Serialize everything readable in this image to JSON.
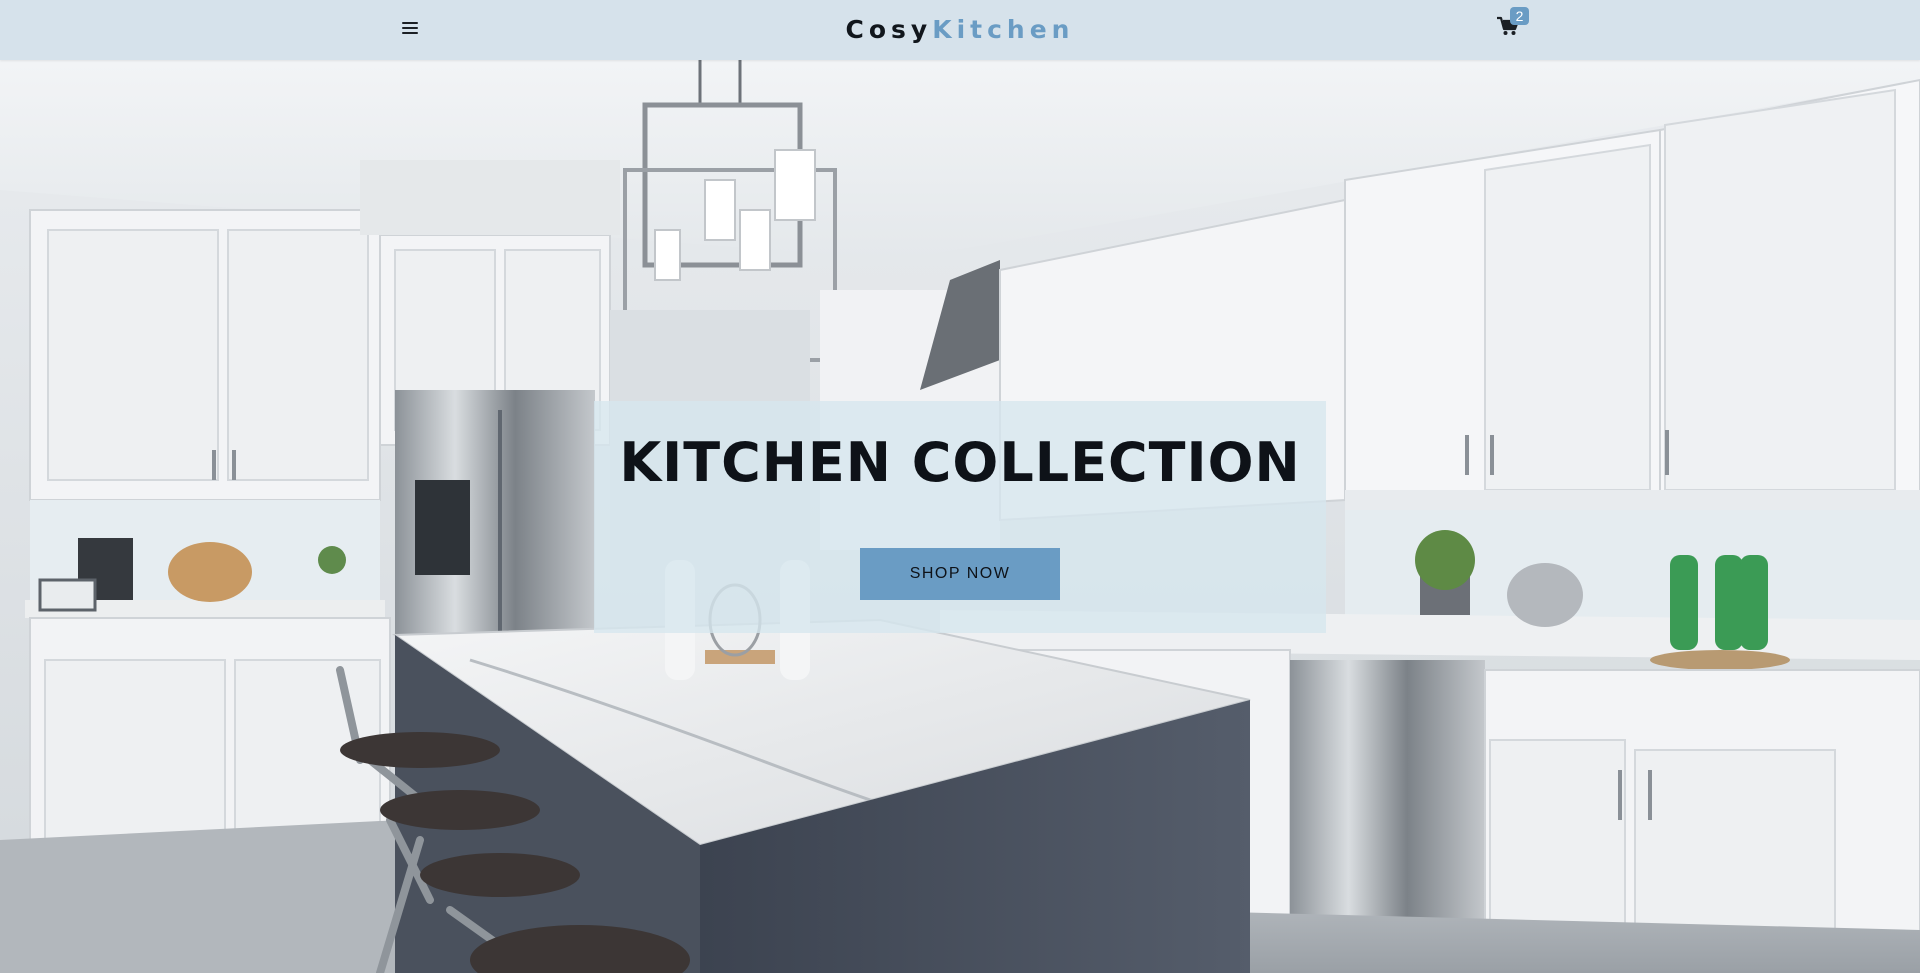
{
  "header": {
    "brand_part1": "Cosy",
    "brand_part2": "Kitchen",
    "cart_count": "2",
    "menu_icon": "hamburger-menu-icon",
    "cart_icon": "shopping-cart-icon"
  },
  "hero": {
    "title": "KITCHEN COLLECTION",
    "cta_label": "SHOP NOW",
    "background": "kitchen-photo"
  },
  "colors": {
    "accent": "#6a9cc4",
    "navbar": "#d6e2eb",
    "text_dark": "#0e1218"
  }
}
